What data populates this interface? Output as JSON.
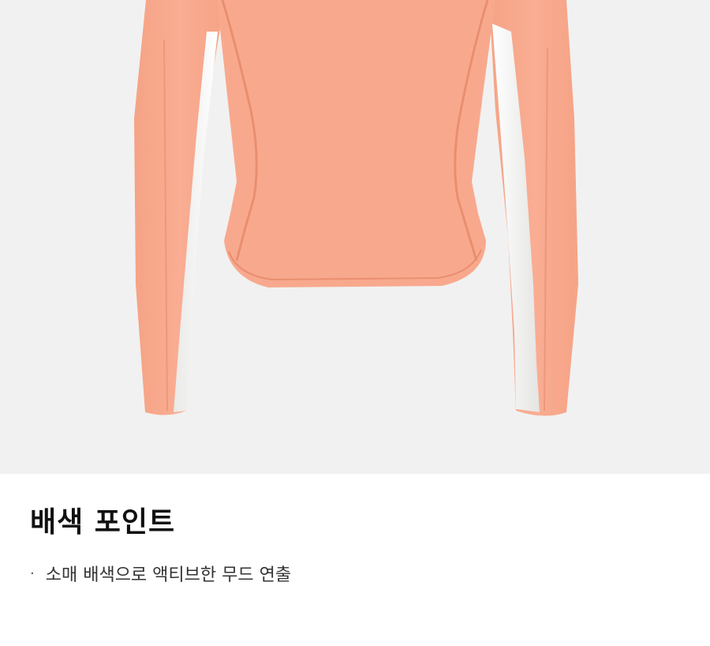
{
  "section": {
    "title": "배색 포인트",
    "bullet_symbol": "·",
    "bullet_text": "소매 배색으로 액티브한 무드 연출"
  },
  "colors": {
    "background": "#f1f1f1",
    "garment": "#f8a98d",
    "garment_seam": "#ea8e70",
    "panel": "#f4f4f2"
  }
}
